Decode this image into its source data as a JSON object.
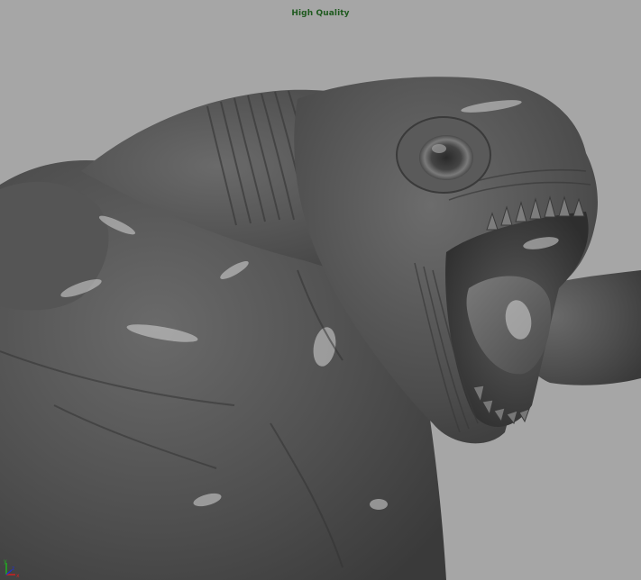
{
  "viewport": {
    "label": "High Quality",
    "label_color": "#1f5a1f",
    "background_color": "#a6a6a6",
    "shading_mode": "high-quality"
  },
  "model": {
    "name": "creature-sculpt",
    "material_color": "#595959",
    "highlight_color": "#d8d8d8"
  },
  "axis_gizmo": {
    "x_label": "x",
    "y_label": "y",
    "z_label": "z",
    "x_color": "#d02020",
    "y_color": "#20b020",
    "z_color": "#2030d0"
  }
}
